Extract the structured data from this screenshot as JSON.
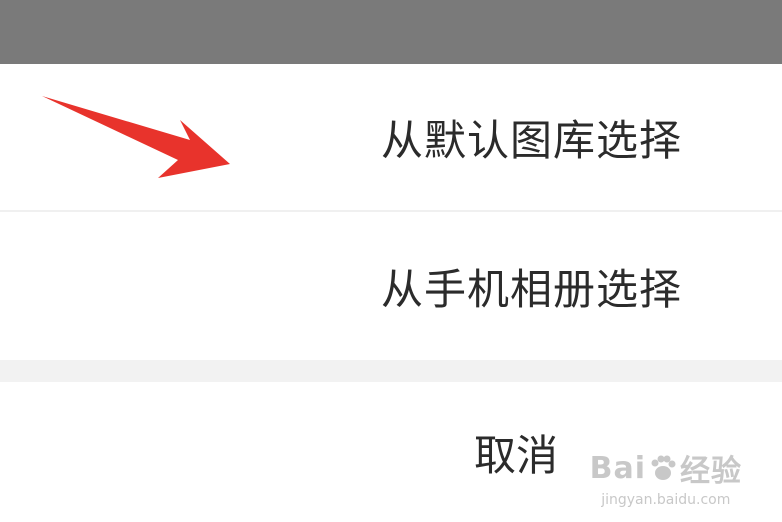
{
  "action_sheet": {
    "option_default_gallery": "从默认图库选择",
    "option_phone_album": "从手机相册选择",
    "cancel_label": "取消"
  },
  "annotation": {
    "arrow_color": "#e8332c"
  },
  "watermark": {
    "logo_text_left": "Bai",
    "logo_text_right": "经验",
    "url": "jingyan.baidu.com"
  },
  "colors": {
    "overlay": "#7a7a7a",
    "sheet_bg": "#ffffff",
    "separator": "#f2f2f2",
    "text": "#2b2b2b"
  }
}
